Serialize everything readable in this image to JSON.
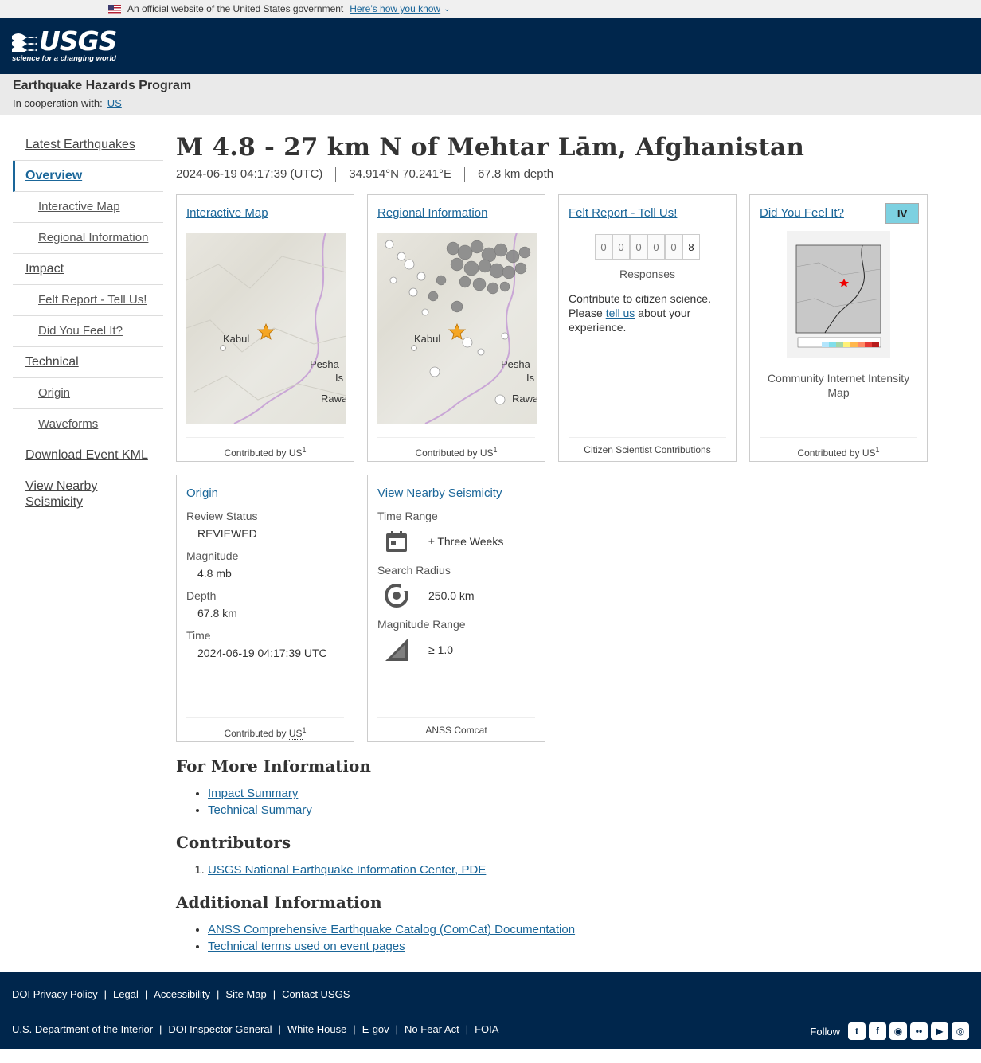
{
  "gov_banner": {
    "text": "An official website of the United States government",
    "link": "Here’s how you know"
  },
  "header": {
    "logo_text": "USGS",
    "logo_tagline": "science for a changing world"
  },
  "program": {
    "title": "Earthquake Hazards Program",
    "coop_label": "In cooperation with:",
    "coop_link": "US"
  },
  "sidebar": {
    "items": [
      {
        "label": "Latest Earthquakes"
      },
      {
        "label": "Overview"
      },
      {
        "label": "Interactive Map"
      },
      {
        "label": "Regional Information"
      },
      {
        "label": "Impact"
      },
      {
        "label": "Felt Report - Tell Us!"
      },
      {
        "label": "Did You Feel It?"
      },
      {
        "label": "Technical"
      },
      {
        "label": "Origin"
      },
      {
        "label": "Waveforms"
      },
      {
        "label": "Download Event KML"
      },
      {
        "label": "View Nearby Seismicity"
      }
    ]
  },
  "event": {
    "title": "M 4.8 - 27 km N of Mehtar Lām, Afghanistan",
    "time": "2024-06-19 04:17:39 (UTC)",
    "location": "34.914°N 70.241°E",
    "depth": "67.8 km depth"
  },
  "cards": {
    "contributed_by": "Contributed by",
    "contributor_abbr": "US",
    "contributor_sup": "1",
    "interactive_map": {
      "title": "Interactive Map",
      "labels": [
        "Kabul",
        "Pesha",
        "Is",
        "Rawa"
      ]
    },
    "regional": {
      "title": "Regional Information",
      "labels": [
        "Kabul",
        "Pesha",
        "Is",
        "Rawa"
      ]
    },
    "felt": {
      "title": "Felt Report - Tell Us!",
      "digits": [
        "0",
        "0",
        "0",
        "0",
        "0",
        "8"
      ],
      "responses_label": "Responses",
      "text_1": "Contribute to citizen science. Please ",
      "text_link": "tell us",
      "text_2": " about your experience.",
      "footer": "Citizen Scientist Contributions"
    },
    "dyfi": {
      "title": "Did You Feel It?",
      "badge": "IV",
      "caption": "Community Internet Intensity Map"
    },
    "origin": {
      "title": "Origin",
      "review_label": "Review Status",
      "review_value": "REVIEWED",
      "magnitude_label": "Magnitude",
      "magnitude_value": "4.8 mb",
      "depth_label": "Depth",
      "depth_value": "67.8 km",
      "time_label": "Time",
      "time_value": "2024-06-19 04:17:39 UTC"
    },
    "nearby": {
      "title": "View Nearby Seismicity",
      "time_label": "Time Range",
      "time_value": "± Three Weeks",
      "radius_label": "Search Radius",
      "radius_value": "250.0 km",
      "mag_label": "Magnitude Range",
      "mag_value": "≥ 1.0",
      "footer": "ANSS Comcat"
    }
  },
  "more_info": {
    "heading": "For More Information",
    "links": [
      "Impact Summary",
      "Technical Summary"
    ]
  },
  "contributors": {
    "heading": "Contributors",
    "items": [
      "USGS National Earthquake Information Center, PDE"
    ]
  },
  "additional": {
    "heading": "Additional Information",
    "links": [
      "ANSS Comprehensive Earthquake Catalog (ComCat) Documentation",
      "Technical terms used on event pages"
    ]
  },
  "footer": {
    "row1": [
      "DOI Privacy Policy",
      "Legal",
      "Accessibility",
      "Site Map",
      "Contact USGS"
    ],
    "row2": [
      "U.S. Department of the Interior",
      "DOI Inspector General",
      "White House",
      "E-gov",
      "No Fear Act",
      "FOIA"
    ],
    "follow_label": "Follow",
    "social": [
      "twitter-icon",
      "facebook-icon",
      "github-icon",
      "flickr-icon",
      "youtube-icon",
      "instagram-icon"
    ]
  },
  "colors": {
    "header_bg": "#00264c",
    "link": "#1a6699",
    "mmi_iv": "#7dd1e1",
    "star": "#f5a623"
  }
}
